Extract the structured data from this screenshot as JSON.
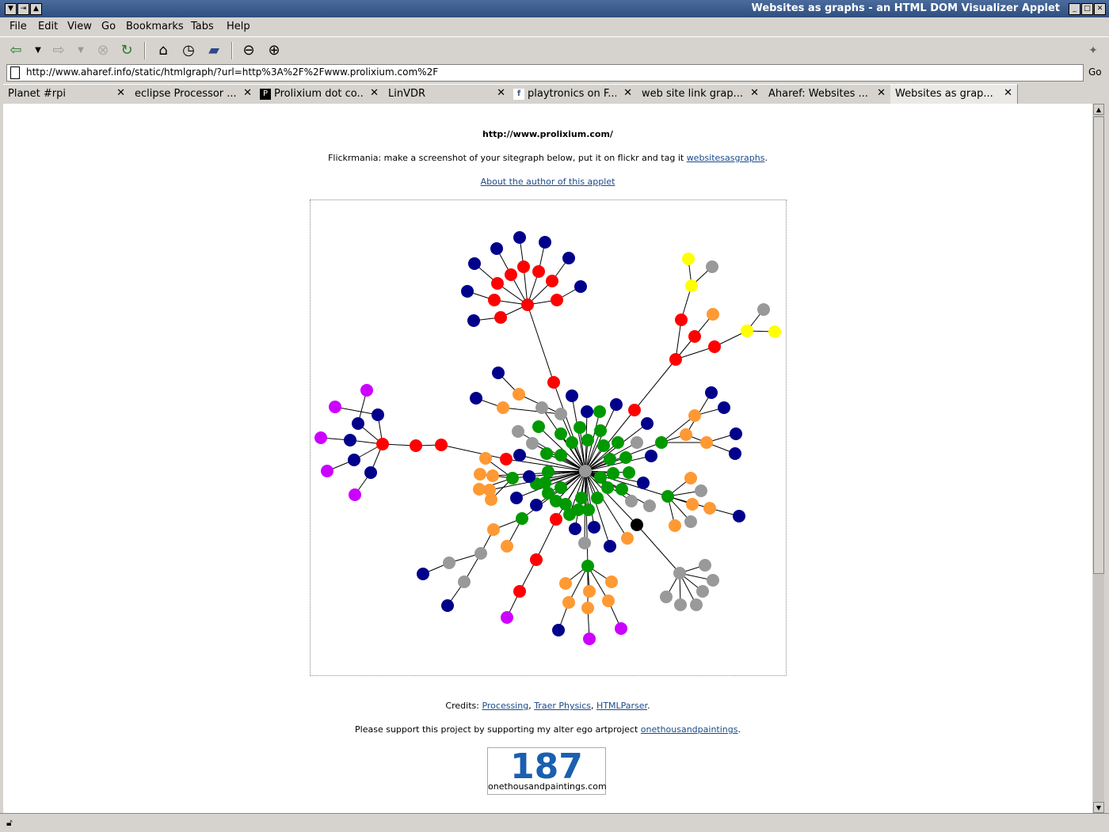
{
  "window": {
    "title": "Websites as graphs - an HTML DOM Visualizer Applet"
  },
  "menu": [
    "File",
    "Edit",
    "View",
    "Go",
    "Bookmarks",
    "Tabs",
    "Help"
  ],
  "url": {
    "value": "http://www.aharef.info/static/htmlgraph/?url=http%3A%2F%2Fwww.prolixium.com%2F",
    "go": "Go"
  },
  "tabs": [
    {
      "label": "Planet #rpi"
    },
    {
      "label": "eclipse Processor ..."
    },
    {
      "label": "Prolixium dot co..."
    },
    {
      "label": "LinVDR"
    },
    {
      "label": "playtronics on F..."
    },
    {
      "label": "web site link grap..."
    },
    {
      "label": "Aharef: Websites ..."
    },
    {
      "label": "Websites as grap..."
    }
  ],
  "page": {
    "site_url": "http://www.prolixium.com/",
    "flickr_text": "Flickrmania: make a screenshot of your sitegraph below, put it on flickr and tag it",
    "flickr_link": "websitesasgraphs",
    "about_link": "About the author of this applet",
    "credits_label": "Credits:",
    "credits": [
      "Processing",
      "Traer Physics",
      "HTMLParser"
    ],
    "support_text": "Please support this project by supporting my alter ego artproject",
    "support_link": "onethousandpaintings",
    "badge_number": "187",
    "badge_site": "onethousandpaintings.com"
  },
  "colors": {
    "blue": "#00008b",
    "red": "#ff0000",
    "green": "#009900",
    "orange": "#ff9933",
    "gray": "#999999",
    "yellow": "#ffff00",
    "violet": "#cc00ff",
    "black": "#000000"
  }
}
